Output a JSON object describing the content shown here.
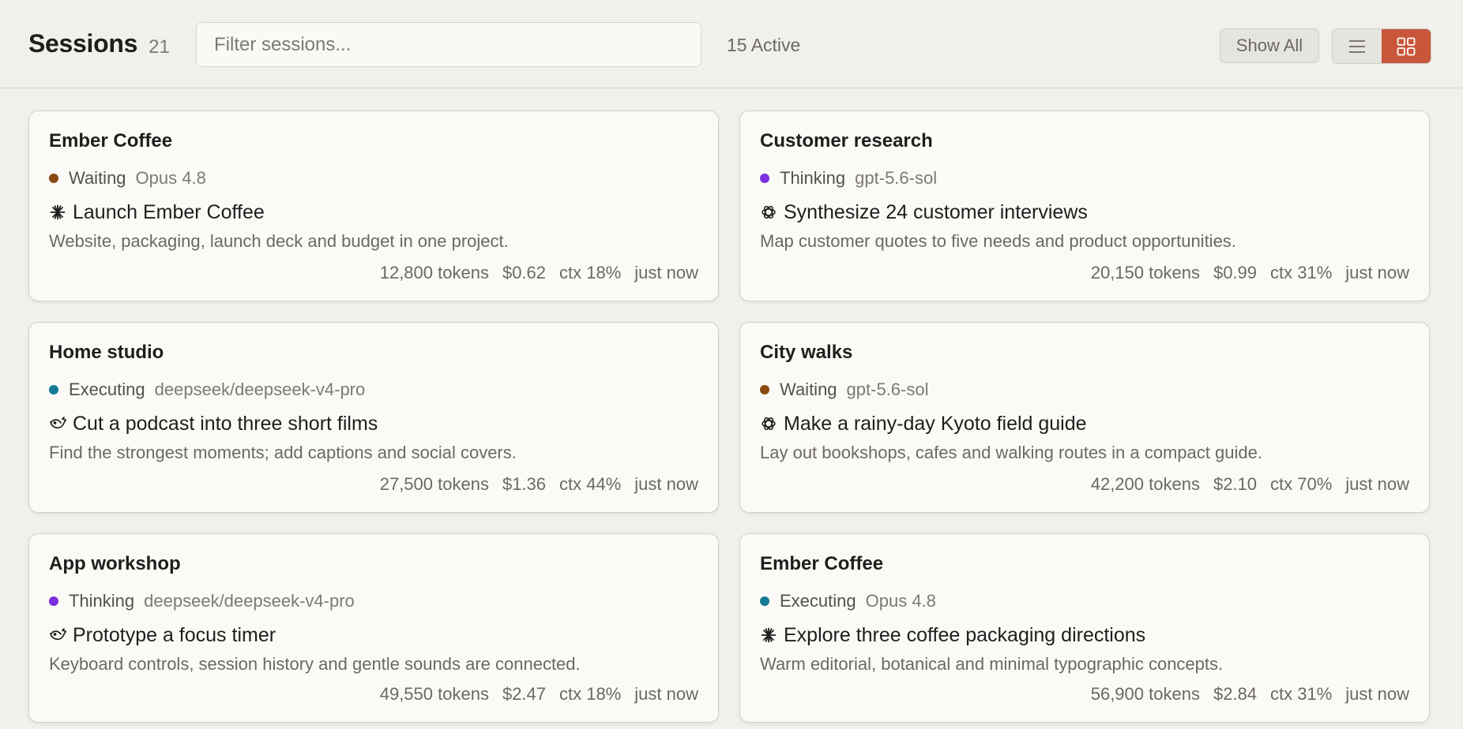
{
  "header": {
    "title": "Sessions",
    "count": "21",
    "filter_placeholder": "Filter sessions...",
    "active_label": "15 Active",
    "show_all_label": "Show All",
    "view_modes": [
      "list",
      "grid"
    ],
    "active_view": "grid"
  },
  "colors": {
    "accent": "#c9553a",
    "waiting": "#8a4b12",
    "thinking": "#7a2fe0",
    "executing": "#137a96"
  },
  "sessions": [
    {
      "project": "Ember Coffee",
      "status": "Waiting",
      "status_color": "#8a4b12",
      "model": "Opus 4.8",
      "icon": "claude-asterisk-icon",
      "task": "Launch Ember Coffee",
      "description": "Website, packaging, launch deck and budget in one project.",
      "tokens": "12,800 tokens",
      "cost": "$0.62",
      "ctx": "ctx 18%",
      "time": "just now"
    },
    {
      "project": "Customer research",
      "status": "Thinking",
      "status_color": "#7a2fe0",
      "model": "gpt-5.6-sol",
      "icon": "openai-knot-icon",
      "task": "Synthesize 24 customer interviews",
      "description": "Map customer quotes to five needs and product opportunities.",
      "tokens": "20,150 tokens",
      "cost": "$0.99",
      "ctx": "ctx 31%",
      "time": "just now"
    },
    {
      "project": "Home studio",
      "status": "Executing",
      "status_color": "#137a96",
      "model": "deepseek/deepseek-v4-pro",
      "icon": "deepseek-whale-icon",
      "task": "Cut a podcast into three short films",
      "description": "Find the strongest moments; add captions and social covers.",
      "tokens": "27,500 tokens",
      "cost": "$1.36",
      "ctx": "ctx 44%",
      "time": "just now"
    },
    {
      "project": "City walks",
      "status": "Waiting",
      "status_color": "#8a4b12",
      "model": "gpt-5.6-sol",
      "icon": "openai-knot-icon",
      "task": "Make a rainy-day Kyoto field guide",
      "description": "Lay out bookshops, cafes and walking routes in a compact guide.",
      "tokens": "42,200 tokens",
      "cost": "$2.10",
      "ctx": "ctx 70%",
      "time": "just now"
    },
    {
      "project": "App workshop",
      "status": "Thinking",
      "status_color": "#7a2fe0",
      "model": "deepseek/deepseek-v4-pro",
      "icon": "deepseek-whale-icon",
      "task": "Prototype a focus timer",
      "description": "Keyboard controls, session history and gentle sounds are connected.",
      "tokens": "49,550 tokens",
      "cost": "$2.47",
      "ctx": "ctx 18%",
      "time": "just now"
    },
    {
      "project": "Ember Coffee",
      "status": "Executing",
      "status_color": "#137a96",
      "model": "Opus 4.8",
      "icon": "claude-asterisk-icon",
      "task": "Explore three coffee packaging directions",
      "description": "Warm editorial, botanical and minimal typographic concepts.",
      "tokens": "56,900 tokens",
      "cost": "$2.84",
      "ctx": "ctx 31%",
      "time": "just now"
    }
  ]
}
